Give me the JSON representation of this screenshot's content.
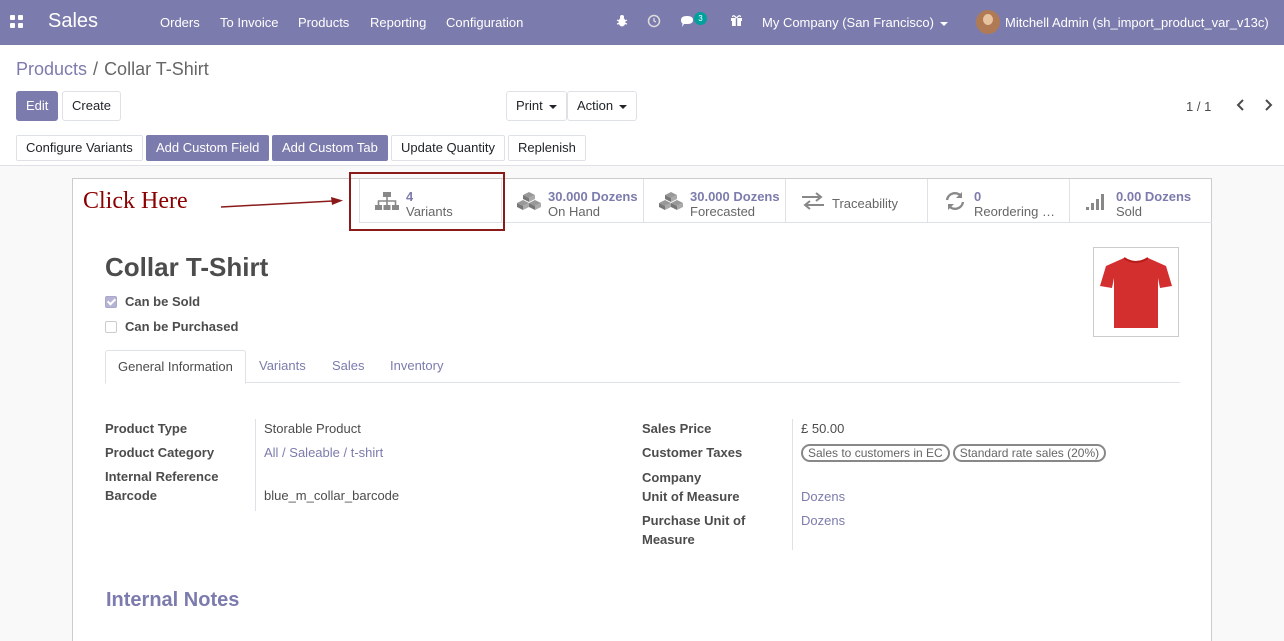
{
  "navbar": {
    "app_name": "Sales",
    "menu": [
      "Orders",
      "To Invoice",
      "Products",
      "Reporting",
      "Configuration"
    ],
    "messages_badge": "3",
    "company": "My Company (San Francisco)",
    "user": "Mitchell Admin (sh_import_product_var_v13c)",
    "icons": [
      "apps-icon",
      "bug-icon",
      "clock-icon",
      "chat-icon",
      "gift-icon"
    ]
  },
  "breadcrumb": {
    "parent": "Products",
    "separator": "/",
    "current": "Collar T-Shirt"
  },
  "control": {
    "edit": "Edit",
    "create": "Create",
    "print": "Print",
    "action": "Action",
    "pager": "1 / 1"
  },
  "header_buttons": [
    "Configure Variants",
    "Add Custom Field",
    "Add Custom Tab",
    "Update Quantity",
    "Replenish"
  ],
  "annotation": {
    "text": "Click Here",
    "color": "#8b0000"
  },
  "smart_buttons": [
    {
      "value": "4",
      "label": "Variants",
      "icon": "sitemap-icon"
    },
    {
      "value": "30.000 Dozens",
      "label": "On Hand",
      "icon": "cubes-icon"
    },
    {
      "value": "30.000 Dozens",
      "label": "Forecasted",
      "icon": "cubes-icon"
    },
    {
      "value": "",
      "label": "Traceability",
      "icon": "exchange-icon"
    },
    {
      "value": "0",
      "label": "Reordering Rules",
      "icon": "refresh-icon"
    },
    {
      "value": "0.00 Dozens",
      "label": "Sold",
      "icon": "signal-icon"
    }
  ],
  "product": {
    "name": "Collar T-Shirt",
    "can_be_sold_label": "Can be Sold",
    "can_be_sold": true,
    "can_be_purchased_label": "Can be Purchased",
    "can_be_purchased": false,
    "image_color": "#d32f2f"
  },
  "tabs": [
    "General Information",
    "Variants",
    "Sales",
    "Inventory"
  ],
  "fields_left": {
    "product_type_label": "Product Type",
    "product_type": "Storable Product",
    "category_label": "Product Category",
    "category": "All / Saleable / t-shirt",
    "internal_ref_label": "Internal Reference",
    "barcode_label": "Barcode",
    "barcode": "blue_m_collar_barcode"
  },
  "fields_right": {
    "sales_price_label": "Sales Price",
    "sales_price": "£ 50.00",
    "customer_taxes_label": "Customer Taxes",
    "taxes": [
      "Sales to customers in EC",
      "Standard rate sales (20%)"
    ],
    "company_label": "Company",
    "uom_label": "Unit of Measure",
    "uom": "Dozens",
    "purchase_uom_label_1": "Purchase Unit of",
    "purchase_uom_label_2": "Measure",
    "purchase_uom": "Dozens"
  },
  "internal_notes_title": "Internal Notes",
  "colors": {
    "brand": "#7c7bad",
    "annotation": "#8b1a1a"
  }
}
